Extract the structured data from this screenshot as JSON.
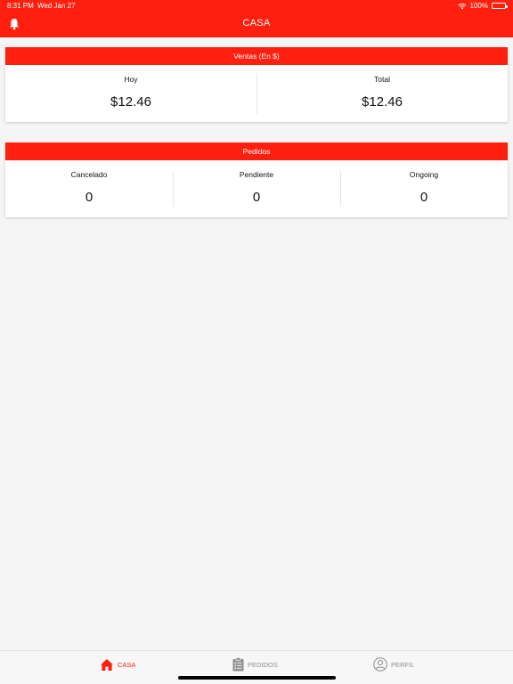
{
  "status_bar": {
    "time": "8:31 PM",
    "date": "Wed Jan 27",
    "battery": "100%"
  },
  "nav": {
    "title": "CASA",
    "bell_icon": "bell-icon"
  },
  "ventas": {
    "title": "Ventas (En $)",
    "cells": [
      {
        "label": "Hoy",
        "value": "$12.46"
      },
      {
        "label": "Total",
        "value": "$12.46"
      }
    ]
  },
  "pedidos": {
    "title": "Pedidos",
    "cells": [
      {
        "label": "Cancelado",
        "value": "0"
      },
      {
        "label": "Pendiente",
        "value": "0"
      },
      {
        "label": "Ongoing",
        "value": "0"
      }
    ]
  },
  "tabs": [
    {
      "label": "CASA",
      "icon": "home-icon",
      "active": true
    },
    {
      "label": "PEDIDOS",
      "icon": "clipboard-icon",
      "active": false
    },
    {
      "label": "PERFIL",
      "icon": "user-icon",
      "active": false
    }
  ],
  "colors": {
    "brand_red": "#ff1f0f",
    "background": "#f5f5f5",
    "inactive_tab": "#8e8e8e"
  }
}
